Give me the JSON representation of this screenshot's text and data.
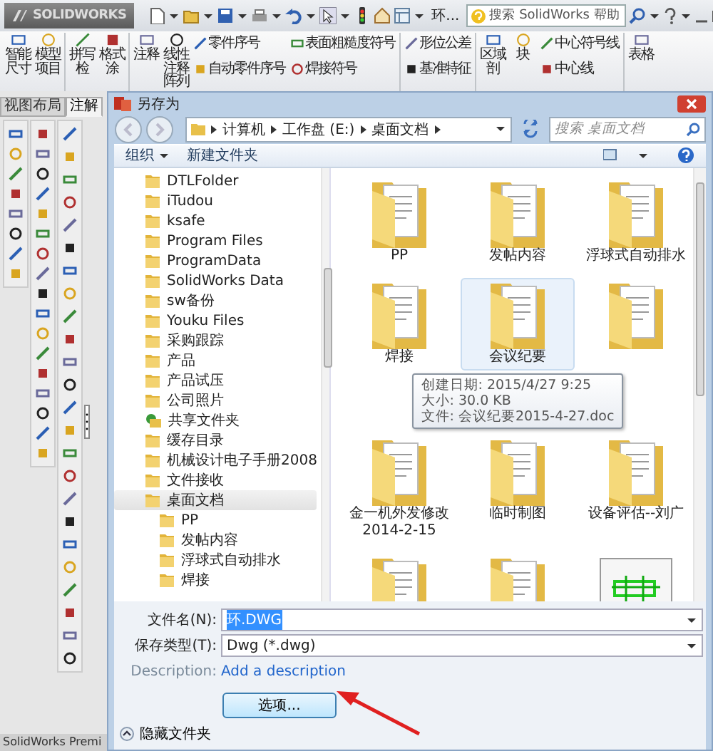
{
  "titlebar": {
    "logo": "SOLIDWORKS",
    "document": "环...",
    "search": {
      "placeholder": "搜索 SolidWorks 帮助"
    }
  },
  "ribbon": [
    {
      "kind": "large",
      "label": "智能尺寸"
    },
    {
      "kind": "large",
      "label": "模型项目"
    },
    {
      "kind": "separator"
    },
    {
      "kind": "large",
      "label": "拼写检"
    },
    {
      "kind": "large",
      "label": "格式涂"
    },
    {
      "kind": "separator"
    },
    {
      "kind": "large",
      "label": "注释"
    },
    {
      "kind": "large",
      "label": "线性注释阵列"
    },
    {
      "kind": "stack",
      "items": [
        "零件序号",
        "自动零件序号"
      ]
    },
    {
      "kind": "stack",
      "items": [
        "表面粗糙度符号",
        "焊接符号"
      ]
    },
    {
      "kind": "separator"
    },
    {
      "kind": "stack",
      "items": [
        "形位公差",
        "基准特征"
      ]
    },
    {
      "kind": "separator"
    },
    {
      "kind": "large",
      "label": "区域剖"
    },
    {
      "kind": "large",
      "label": "块"
    },
    {
      "kind": "stack",
      "items": [
        "中心符号线",
        "中心线"
      ]
    },
    {
      "kind": "separator"
    },
    {
      "kind": "large",
      "label": "表格"
    }
  ],
  "side_panel": {
    "tabs": [
      {
        "label": "视图布局",
        "selected": false
      },
      {
        "label": "注解",
        "selected": true
      }
    ]
  },
  "status_bar": {
    "text": "SolidWorks Premi"
  },
  "dialog": {
    "title": "另存为",
    "breadcrumb": [
      "计算机",
      "工作盘 (E:)",
      "桌面文档"
    ],
    "search": {
      "placeholder": "搜索 桌面文档"
    },
    "toolbar": {
      "organize": "组织",
      "new_folder": "新建文件夹"
    },
    "tree": [
      {
        "label": "DTLFolder",
        "kind": "folder",
        "selected": false
      },
      {
        "label": "iTudou",
        "kind": "folder",
        "selected": false
      },
      {
        "label": "ksafe",
        "kind": "folder",
        "selected": false
      },
      {
        "label": "Program Files",
        "kind": "folder",
        "selected": false
      },
      {
        "label": "ProgramData",
        "kind": "folder",
        "selected": false
      },
      {
        "label": "SolidWorks Data",
        "kind": "folder",
        "selected": false
      },
      {
        "label": "sw备份",
        "kind": "folder",
        "selected": false
      },
      {
        "label": "Youku Files",
        "kind": "folder",
        "selected": false
      },
      {
        "label": "采购跟踪",
        "kind": "folder",
        "selected": false
      },
      {
        "label": "产品",
        "kind": "folder",
        "selected": false
      },
      {
        "label": "产品试压",
        "kind": "folder",
        "selected": false
      },
      {
        "label": "公司照片",
        "kind": "folder",
        "selected": false
      },
      {
        "label": "共享文件夹",
        "kind": "shared",
        "selected": false
      },
      {
        "label": "缓存目录",
        "kind": "folder",
        "selected": false
      },
      {
        "label": "机械设计电子手册2008",
        "kind": "folder",
        "selected": false
      },
      {
        "label": "文件接收",
        "kind": "folder",
        "selected": false
      },
      {
        "label": "桌面文档",
        "kind": "folder",
        "selected": true,
        "children": [
          {
            "label": "PP",
            "kind": "folder",
            "selected": false
          },
          {
            "label": "发帖内容",
            "kind": "folder",
            "selected": false
          },
          {
            "label": "浮球式自动排水",
            "kind": "folder",
            "selected": false
          },
          {
            "label": "焊接",
            "kind": "folder",
            "selected": false
          }
        ]
      }
    ],
    "files": [
      {
        "label": "PP",
        "kind": "folder",
        "hovered": false
      },
      {
        "label": "发帖内容",
        "kind": "folder",
        "hovered": false
      },
      {
        "label": "浮球式自动排水",
        "kind": "folder",
        "hovered": false
      },
      {
        "label": "焊接",
        "kind": "folder",
        "hovered": false
      },
      {
        "label": "会议纪要",
        "kind": "folder",
        "hovered": true
      },
      {
        "kind": "folder",
        "hovered": false
      },
      {
        "label": "金一机外发修改\n2014-2-15",
        "kind": "folder",
        "hovered": false
      },
      {
        "label": "临时制图",
        "kind": "folder",
        "hovered": false
      },
      {
        "label": "设备评估--刘广",
        "kind": "folder",
        "hovered": false
      },
      {
        "kind": "folder",
        "hovered": false
      },
      {
        "kind": "folder",
        "hovered": false
      },
      {
        "kind": "image",
        "hovered": false
      }
    ],
    "tooltip": {
      "lines": [
        "创建日期: 2015/4/27 9:25",
        "大小: 30.0 KB",
        "文件: 会议纪要2015-4-27.doc"
      ]
    },
    "form": {
      "filename": {
        "label": "文件名(N):",
        "value": "环.DWG"
      },
      "filetype": {
        "label": "保存类型(T):",
        "value": "Dwg (*.dwg)"
      },
      "description": {
        "label": "Description:",
        "link": "Add a description"
      },
      "options_button": "选项...",
      "hide_folders": "隐藏文件夹"
    }
  }
}
